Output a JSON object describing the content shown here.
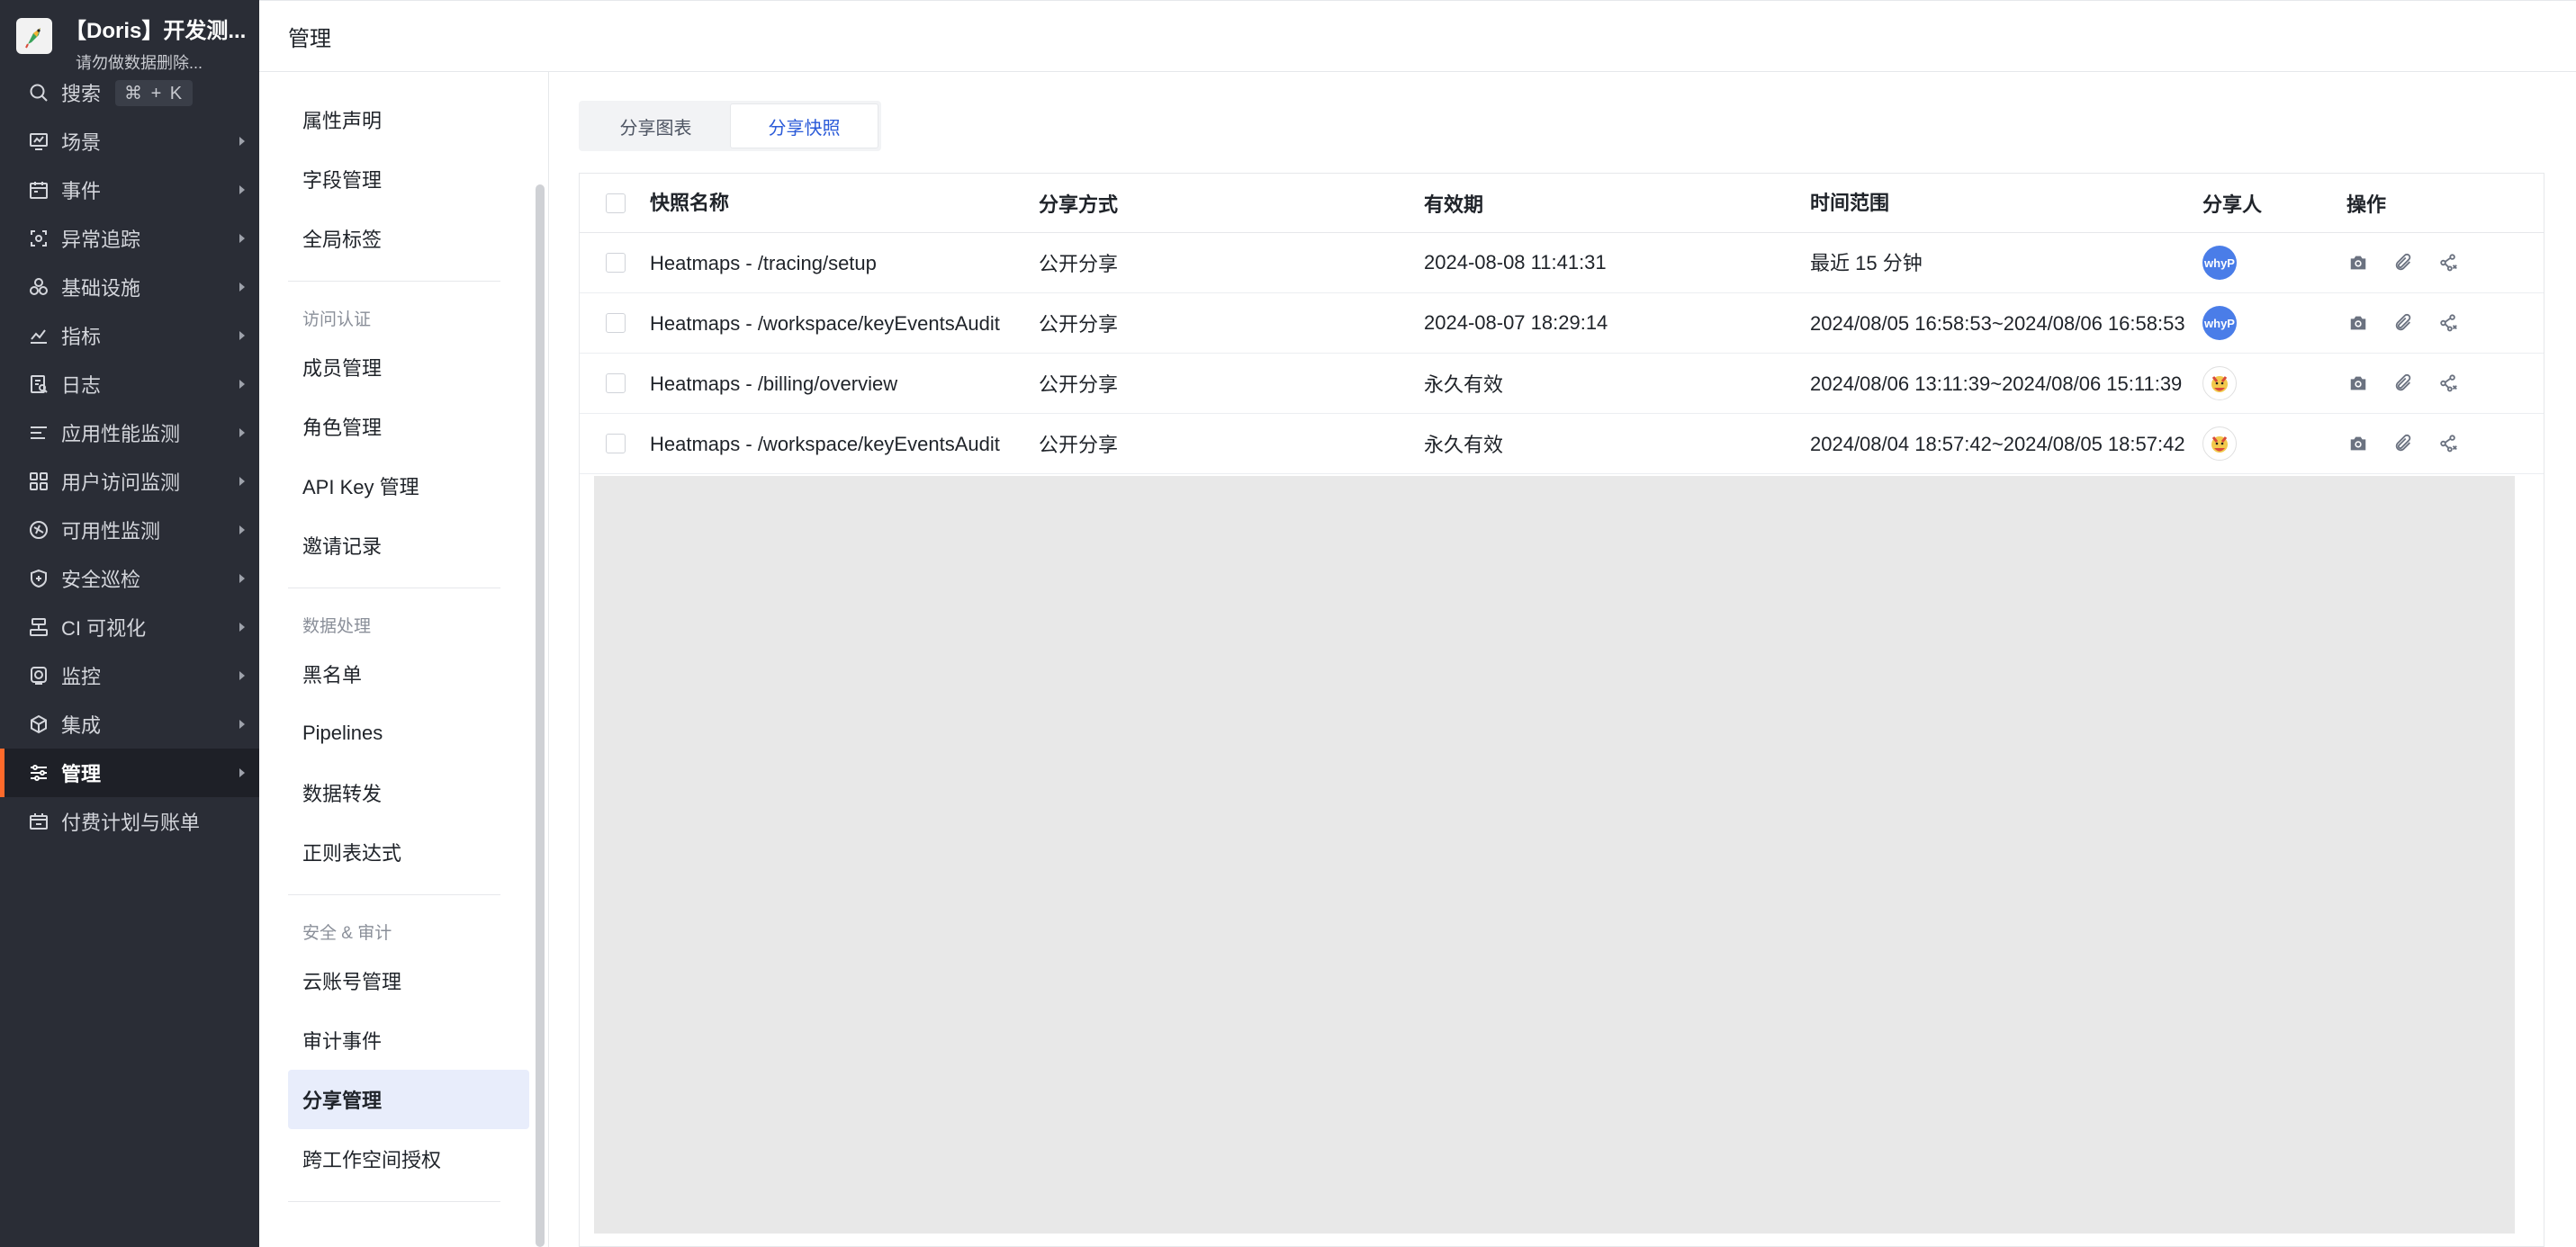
{
  "workspace": {
    "name": "【Doris】开发测...",
    "subtitle": "请勿做数据删除..."
  },
  "nav": {
    "search": {
      "label": "搜索",
      "shortcut": "⌘ + K"
    },
    "items": [
      {
        "label": "场景",
        "icon": "monitor-icon"
      },
      {
        "label": "事件",
        "icon": "calendar-icon"
      },
      {
        "label": "异常追踪",
        "icon": "tracking-icon"
      },
      {
        "label": "基础设施",
        "icon": "infrastructure-icon"
      },
      {
        "label": "指标",
        "icon": "metrics-icon"
      },
      {
        "label": "日志",
        "icon": "logs-icon"
      },
      {
        "label": "应用性能监测",
        "icon": "apm-icon"
      },
      {
        "label": "用户访问监测",
        "icon": "rum-icon"
      },
      {
        "label": "可用性监测",
        "icon": "availability-icon"
      },
      {
        "label": "安全巡检",
        "icon": "shield-icon"
      },
      {
        "label": "CI 可视化",
        "icon": "ci-icon"
      },
      {
        "label": "监控",
        "icon": "monitor-target-icon"
      },
      {
        "label": "集成",
        "icon": "integration-icon"
      },
      {
        "label": "管理",
        "icon": "sliders-icon",
        "active": true
      },
      {
        "label": "付费计划与账单",
        "icon": "billing-icon"
      }
    ]
  },
  "header": {
    "title": "管理"
  },
  "submenu": {
    "top_items": [
      "属性声明",
      "字段管理",
      "全局标签"
    ],
    "groups": [
      {
        "title": "访问认证",
        "items": [
          "成员管理",
          "角色管理",
          "API Key 管理",
          "邀请记录"
        ]
      },
      {
        "title": "数据处理",
        "items": [
          "黑名单",
          "Pipelines",
          "数据转发",
          "正则表达式"
        ]
      },
      {
        "title": "安全 & 审计",
        "items": [
          "云账号管理",
          "审计事件",
          "分享管理",
          "跨工作空间授权"
        ]
      }
    ],
    "active_item": "分享管理"
  },
  "tabs": [
    {
      "label": "分享图表",
      "active": false
    },
    {
      "label": "分享快照",
      "active": true
    }
  ],
  "table": {
    "columns": [
      "快照名称",
      "分享方式",
      "有效期",
      "时间范围",
      "分享人",
      "操作"
    ],
    "rows": [
      {
        "name": "Heatmaps - /tracing/setup",
        "mode": "公开分享",
        "expiry": "2024-08-08 11:41:31",
        "range": "最近 15 分钟",
        "user_initials": "whyP",
        "avatar_type": "blue"
      },
      {
        "name": "Heatmaps - /workspace/keyEventsAudit",
        "mode": "公开分享",
        "expiry": "2024-08-07 18:29:14",
        "range": "2024/08/05 16:58:53~2024/08/06 16:58:53",
        "user_initials": "whyP",
        "avatar_type": "blue"
      },
      {
        "name": "Heatmaps - /billing/overview",
        "mode": "公开分享",
        "expiry": "永久有效",
        "range": "2024/08/06 13:11:39~2024/08/06 15:11:39",
        "user_initials": "",
        "avatar_type": "img"
      },
      {
        "name": "Heatmaps - /workspace/keyEventsAudit",
        "mode": "公开分享",
        "expiry": "永久有效",
        "range": "2024/08/04 18:57:42~2024/08/05 18:57:42",
        "user_initials": "",
        "avatar_type": "img"
      }
    ],
    "operations": [
      "camera-icon",
      "attachment-icon",
      "share-cancel-icon"
    ]
  },
  "colors": {
    "sidebar_bg": "#2a2d36",
    "accent": "#ff6a2b",
    "link": "#2a5ad8",
    "active_menu_bg": "#e8edfb"
  }
}
